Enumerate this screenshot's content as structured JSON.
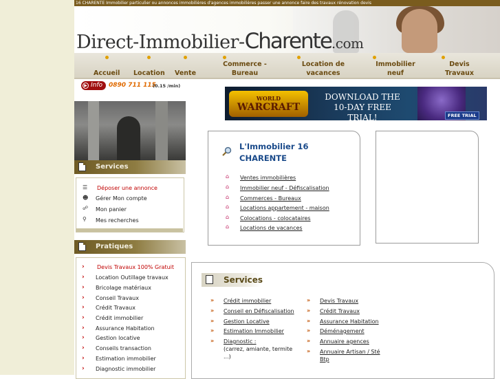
{
  "topbar": "16 CHARENTE Immobilier particulier ou annonces immobilières d'agences immobilières passer une annonce faire des travaux rénovation devis",
  "logo": {
    "part1": "Direct-Immobilier-",
    "part2": "Charente",
    "part3": ".com"
  },
  "nav": [
    {
      "line1": "Accueil",
      "line2": ""
    },
    {
      "line1": "Location",
      "line2": ""
    },
    {
      "line1": "Vente",
      "line2": ""
    },
    {
      "line1": "Commerce -",
      "line2": "Bureau"
    },
    {
      "line1": "Location de",
      "line2": "vacances"
    },
    {
      "line1": "Immobilier",
      "line2": "neuf"
    },
    {
      "line1": "Devis",
      "line2": "Travaux"
    }
  ],
  "info": {
    "label": "Info",
    "number": "0890 711 115",
    "price": "(0.15 /min)"
  },
  "banner": {
    "brand_small": "WORLD",
    "brand": "WARCRAFT",
    "cta_line1": "DOWNLOAD THE",
    "cta_line2": "10-DAY FREE TRIAL!",
    "badge": "FREE TRIAL"
  },
  "left": {
    "services_title": "Services",
    "services_items": [
      {
        "label": "Déposer une annonce",
        "icon": "list-icon",
        "red": true
      },
      {
        "label": "Gérer Mon compte",
        "icon": "user-icon",
        "red": false
      },
      {
        "label": "Mon panier",
        "icon": "cart-icon",
        "red": false
      },
      {
        "label": "Mes recherches",
        "icon": "search-icon",
        "red": false
      }
    ],
    "pratiques_title": "Pratiques",
    "pratiques_items": [
      {
        "label": "Devis Travaux 100% Gratuit",
        "red": true
      },
      {
        "label": "Location Outillage travaux",
        "red": false
      },
      {
        "label": "Bricolage matériaux",
        "red": false
      },
      {
        "label": "Conseil Travaux",
        "red": false
      },
      {
        "label": "Crédit Travaux",
        "red": false
      },
      {
        "label": "Crédit immobilier",
        "red": false
      },
      {
        "label": "Assurance Habitation",
        "red": false
      },
      {
        "label": "Gestion locative",
        "red": false
      },
      {
        "label": "Conseils transaction",
        "red": false
      },
      {
        "label": "Estimation immobilier",
        "red": false
      },
      {
        "label": "Diagnostic immobilier",
        "red": false
      }
    ]
  },
  "main": {
    "title_line1": "L'Immobilier 16",
    "title_line2": "CHARENTE",
    "links": [
      "Ventes immobilières",
      "Immobilier neuf - Défiscalisation",
      "Commerces - Bureaux",
      "Locations appartement - maison",
      "Colocations - colocataires",
      "Locations de vacances"
    ]
  },
  "services": {
    "title": "Services",
    "col1": [
      {
        "label": "Crédit immobilier",
        "sub": []
      },
      {
        "label": "Conseil en Défiscalisation",
        "sub": []
      },
      {
        "label": "Gestion Locative",
        "sub": []
      },
      {
        "label": "Estimation Immobilier",
        "sub": []
      },
      {
        "label": "Diagnostic :",
        "sub": [
          "(carrez, amiante, termite",
          "...)"
        ]
      }
    ],
    "col2": [
      {
        "label": "Devis Travaux",
        "sub": []
      },
      {
        "label": "Crédit Travaux",
        "sub": []
      },
      {
        "label": "Assurance Habitation",
        "sub": []
      },
      {
        "label": "Déménagement",
        "sub": []
      },
      {
        "label": "Annuaire agences",
        "sub": []
      },
      {
        "label": "Annuaire Artisan / Sté",
        "sub": [
          "Btp"
        ]
      }
    ]
  }
}
